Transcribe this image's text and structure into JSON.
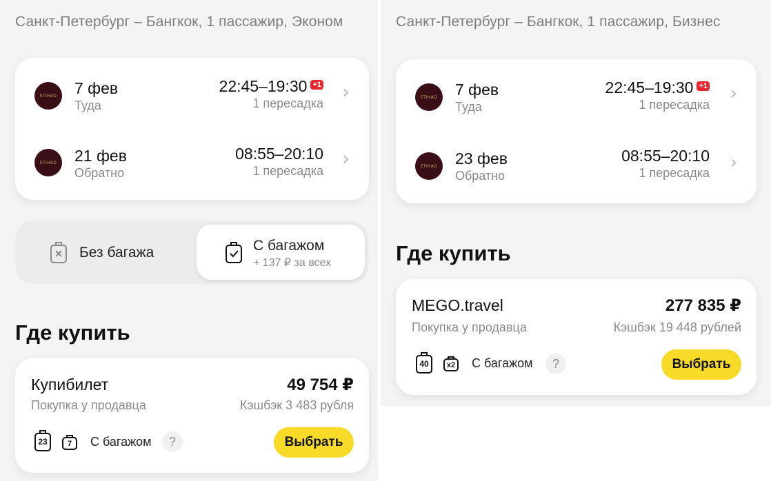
{
  "left": {
    "route": "Санкт-Петербург – Бангкок, 1 пассажир, Эконом",
    "flights": [
      {
        "airline_logo": "ETIHAD",
        "date": "7 фев",
        "direction": "Туда",
        "time": "22:45–19:30",
        "next_day": "+1",
        "stops": "1 пересадка"
      },
      {
        "airline_logo": "ETIHAD",
        "date": "21 фев",
        "direction": "Обратно",
        "time": "08:55–20:10",
        "next_day": "",
        "stops": "1 пересадка"
      }
    ],
    "baggage_toggle": {
      "no_bag_label": "Без багажа",
      "with_bag_label": "С багажом",
      "with_bag_sub": "+ 137 ₽ за всех"
    },
    "where_to_buy": "Где купить",
    "offer": {
      "seller": "Купибилет",
      "seller_sub": "Покупка у продавца",
      "price": "49 754 ₽",
      "cashback": "Кэшбэк 3 483 рубля",
      "bag1": "23",
      "bag2": "7",
      "bag_text": "С багажом",
      "help": "?",
      "select": "Выбрать"
    }
  },
  "right": {
    "route": "Санкт-Петербург – Бангкок, 1 пассажир, Бизнес",
    "flights": [
      {
        "airline_logo": "ETIHAD",
        "date": "7 фев",
        "direction": "Туда",
        "time": "22:45–19:30",
        "next_day": "+1",
        "stops": "1 пересадка"
      },
      {
        "airline_logo": "ETIHAD",
        "date": "23 фев",
        "direction": "Обратно",
        "time": "08:55–20:10",
        "next_day": "",
        "stops": "1 пересадка"
      }
    ],
    "where_to_buy": "Где купить",
    "offer": {
      "seller": "MEGO.travel",
      "seller_sub": "Покупка у продавца",
      "price": "277 835 ₽",
      "cashback": "Кэшбэк 19 448 рублей",
      "bag1": "40",
      "bag2": "x2",
      "bag_text": "С багажом",
      "help": "?",
      "select": "Выбрать"
    }
  },
  "colors": {
    "accent_button": "#f8db29",
    "next_day_badge": "#e8252e",
    "logo_bg": "#3a0e16"
  },
  "icons": [
    "chevron-right-icon",
    "suitcase-cross-icon",
    "suitcase-check-icon",
    "checked-bag-icon",
    "cabin-bag-icon"
  ]
}
